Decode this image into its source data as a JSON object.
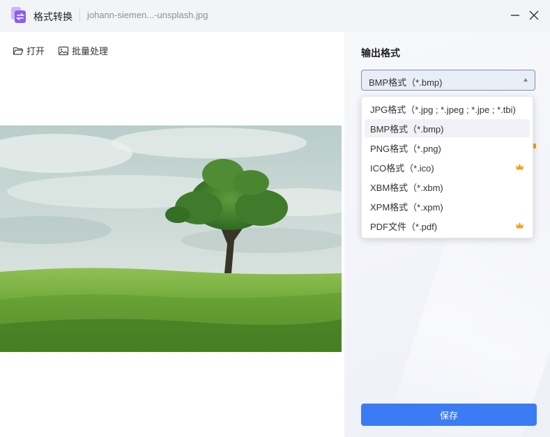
{
  "titlebar": {
    "app_title": "格式转换",
    "file_name": "johann-siemen...-unsplash.jpg"
  },
  "toolbar": {
    "open_label": "打开",
    "batch_label": "批量处理"
  },
  "output": {
    "section_title": "输出格式",
    "selected_value": "BMP格式（*.bmp)"
  },
  "dropdown": {
    "options": [
      {
        "label": "JPG格式（*.jpg ; *.jpeg ; *.jpe ; *.tbi)",
        "premium": false
      },
      {
        "label": "BMP格式（*.bmp)",
        "premium": false,
        "selected": true
      },
      {
        "label": "PNG格式（*.png)",
        "premium": false
      },
      {
        "label": "ICO格式（*.ico)",
        "premium": true
      },
      {
        "label": "XBM格式（*.xbm)",
        "premium": false
      },
      {
        "label": "XPM格式（*.xpm)",
        "premium": false
      },
      {
        "label": "PDF文件（*.pdf)",
        "premium": true
      }
    ]
  },
  "save_label": "保存",
  "colors": {
    "accent": "#3b7cf5",
    "crown": "#f2a21b",
    "app_icon": "#8b5cf6"
  },
  "icons": [
    "app-logo-icon",
    "minimize-icon",
    "close-icon",
    "folder-open-icon",
    "image-batch-icon",
    "caret-up-icon",
    "crown-icon"
  ]
}
